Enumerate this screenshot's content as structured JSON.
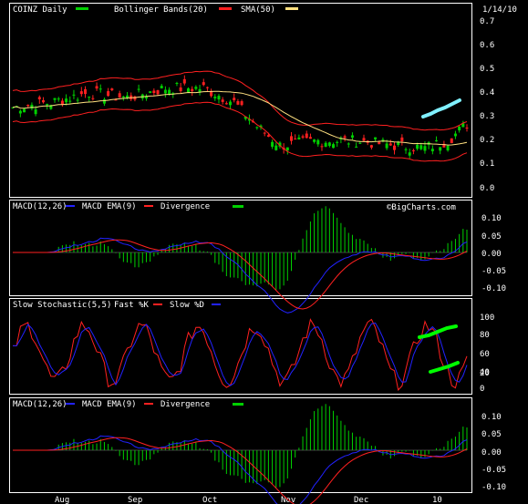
{
  "header": {
    "symbol": "COINZ Daily",
    "indicator": "Bollinger Bands(20)",
    "sma": "SMA(50)",
    "date": "1/14/10",
    "watermark": "©BigCharts.com"
  },
  "colors": {
    "up": "#00d000",
    "down": "#ff2020",
    "bollinger": "#ff2020",
    "sma": "#ffe080",
    "macd": "#2222ff",
    "signal": "#ff2020",
    "divergence": "#00d000",
    "fastK": "#ff2020",
    "slowD": "#2222ff",
    "annotation_cyan": "#80f0ff",
    "annotation_green": "#00ff00",
    "frame": "#ffffff"
  },
  "panels": {
    "price": {
      "ticks": [
        "0.7",
        "0.6",
        "0.5",
        "0.4",
        "0.3",
        "0.2",
        "0.1",
        "0.0"
      ]
    },
    "macd1": {
      "title": "MACD(12,26)",
      "ema": "MACD EMA(9)",
      "div": "Divergence",
      "ticks": [
        "0.10",
        "0.05",
        "0.00",
        "-0.05",
        "-0.10"
      ]
    },
    "stoch": {
      "title": "Slow Stochastic(5,5)",
      "fastk": "Fast %K",
      "slowd": "Slow %D",
      "ticks": [
        "100",
        "80",
        "60",
        "40",
        "20",
        "0"
      ]
    },
    "macd2": {
      "title": "MACD(12,26)",
      "ema": "MACD EMA(9)",
      "div": "Divergence",
      "ticks": [
        "0.10",
        "0.05",
        "0.00",
        "-0.05",
        "-0.10"
      ]
    }
  },
  "xaxis": {
    "labels": [
      "Aug",
      "Sep",
      "Oct",
      "Nov",
      "Dec",
      "10"
    ]
  },
  "chart_data": {
    "type": "line",
    "title": "COINZ Daily",
    "y_range": [
      0.0,
      0.7
    ],
    "series": [
      {
        "name": "Price"
      },
      {
        "name": "Bollinger Bands(20)"
      },
      {
        "name": "SMA(50)"
      }
    ],
    "indicators": [
      "MACD(12,26)",
      "MACD EMA(9)",
      "Divergence",
      "Slow Stochastic(5,5)",
      "Fast %K",
      "Slow %D"
    ]
  }
}
